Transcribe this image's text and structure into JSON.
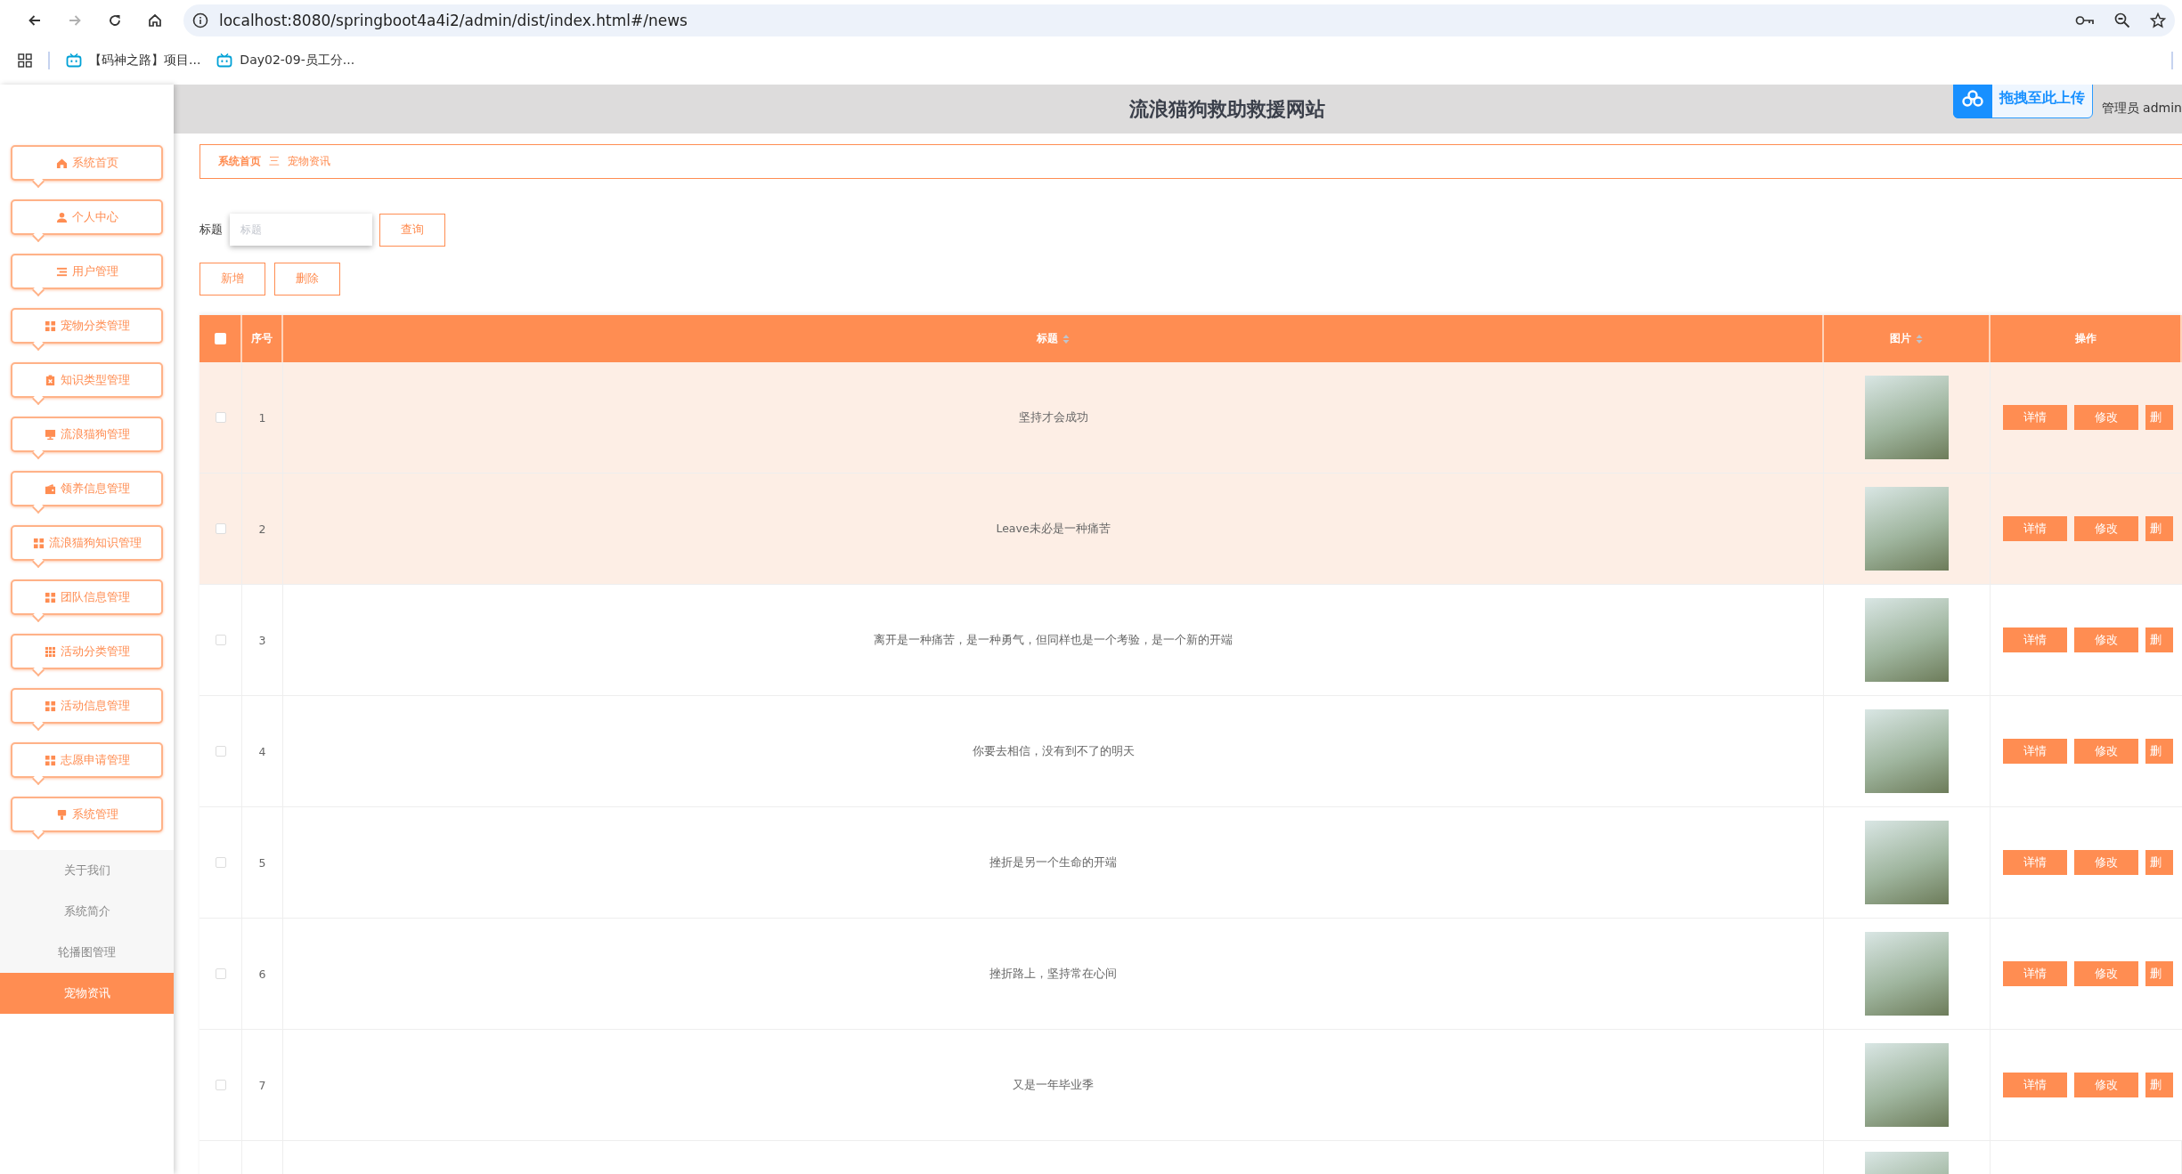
{
  "browser": {
    "nav": [
      {
        "kind": "back",
        "disabled": false
      },
      {
        "kind": "forward",
        "disabled": true
      },
      {
        "kind": "reload",
        "disabled": false
      },
      {
        "kind": "home",
        "disabled": false
      }
    ],
    "url": "localhost:8080/springboot4a4i2/admin/dist/index.html#/news",
    "bookmarks": [
      "【码神之路】项目...",
      "Day02-09-员工分..."
    ]
  },
  "header": {
    "title": "流浪猫狗救助救援网站",
    "upload_label": "拖拽至此上传",
    "user_label": "管理员 admin"
  },
  "sidebar": {
    "items": [
      {
        "label": "系统首页",
        "kind": "home"
      },
      {
        "label": "个人中心",
        "kind": "user"
      },
      {
        "label": "用户管理",
        "kind": "list"
      },
      {
        "label": "宠物分类管理",
        "kind": "grid"
      },
      {
        "label": "知识类型管理",
        "kind": "clipboard"
      },
      {
        "label": "流浪猫狗管理",
        "kind": "monitor"
      },
      {
        "label": "领养信息管理",
        "kind": "wallet"
      },
      {
        "label": "流浪猫狗知识管理",
        "kind": "grid"
      },
      {
        "label": "团队信息管理",
        "kind": "grid"
      },
      {
        "label": "活动分类管理",
        "kind": "grid9"
      },
      {
        "label": "活动信息管理",
        "kind": "grid"
      },
      {
        "label": "志愿申请管理",
        "kind": "grid"
      },
      {
        "label": "系统管理",
        "kind": "brush",
        "children": [
          {
            "label": "关于我们",
            "selected": false
          },
          {
            "label": "系统简介",
            "selected": false
          },
          {
            "label": "轮播图管理",
            "selected": false
          },
          {
            "label": "宠物资讯",
            "selected": true
          }
        ]
      }
    ]
  },
  "breadcrumb": [
    "系统首页",
    "三",
    "宠物资讯"
  ],
  "search": {
    "label": "标题",
    "placeholder": "标题",
    "button": "查询"
  },
  "actions": [
    "新增",
    "删除"
  ],
  "table": {
    "all_checked": false,
    "columns": [
      {
        "label": "序号",
        "sortable": false
      },
      {
        "label": "标题",
        "sortable": true
      },
      {
        "label": "图片",
        "sortable": true
      },
      {
        "label": "操作",
        "sortable": false
      }
    ],
    "rows": [
      {
        "index": "1",
        "title": "坚持才会成功",
        "checked": false,
        "highlighted": true,
        "buttons": [
          "详情",
          "修改",
          "删"
        ]
      },
      {
        "index": "2",
        "title": "Leave未必是一种痛苦",
        "checked": false,
        "highlighted": true,
        "buttons": [
          "详情",
          "修改",
          "删"
        ]
      },
      {
        "index": "3",
        "title": "离开是一种痛苦，是一种勇气，但同样也是一个考验，是一个新的开端",
        "checked": false,
        "highlighted": false,
        "buttons": [
          "详情",
          "修改",
          "删"
        ]
      },
      {
        "index": "4",
        "title": "你要去相信，没有到不了的明天",
        "checked": false,
        "highlighted": false,
        "buttons": [
          "详情",
          "修改",
          "删"
        ]
      },
      {
        "index": "5",
        "title": "挫折是另一个生命的开端",
        "checked": false,
        "highlighted": false,
        "buttons": [
          "详情",
          "修改",
          "删"
        ]
      },
      {
        "index": "6",
        "title": "挫折路上，坚持常在心间",
        "checked": false,
        "highlighted": false,
        "buttons": [
          "详情",
          "修改",
          "删"
        ]
      },
      {
        "index": "7",
        "title": "又是一年毕业季",
        "checked": false,
        "highlighted": false,
        "buttons": [
          "详情",
          "修改",
          "删"
        ]
      }
    ]
  }
}
